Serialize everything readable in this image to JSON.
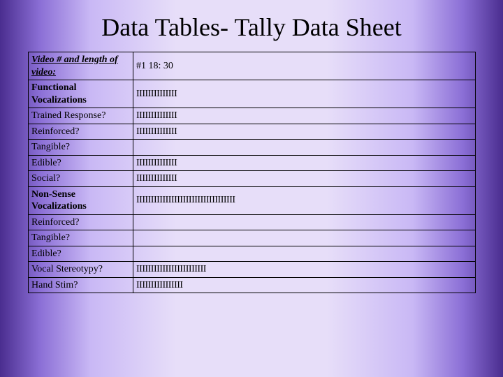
{
  "title": "Data Tables- Tally Data Sheet",
  "header": {
    "label": "Video # and length of video:",
    "value": "#1 18: 30"
  },
  "rows": [
    {
      "label": "Functional Vocalizations",
      "tally": "IIIIIIIIIIIIII",
      "label_class": "section-label",
      "row_class": "two-line"
    },
    {
      "label": "Trained Response?",
      "tally": "IIIIIIIIIIIIII",
      "label_class": "row-label",
      "row_class": ""
    },
    {
      "label": "Reinforced?",
      "tally": "IIIIIIIIIIIIII",
      "label_class": "row-label",
      "row_class": ""
    },
    {
      "label": "Tangible?",
      "tally": "",
      "label_class": "row-label",
      "row_class": ""
    },
    {
      "label": "Edible?",
      "tally": "IIIIIIIIIIIIII",
      "label_class": "row-label",
      "row_class": ""
    },
    {
      "label": "Social?",
      "tally": "IIIIIIIIIIIIII",
      "label_class": "row-label",
      "row_class": ""
    },
    {
      "label": "Non-Sense Vocalizations",
      "tally": "IIIIIIIIIIIIIIIIIIIIIIIIIIIIIIIIII",
      "label_class": "section-label",
      "row_class": "two-line"
    },
    {
      "label": "Reinforced?",
      "tally": "",
      "label_class": "row-label",
      "row_class": ""
    },
    {
      "label": "Tangible?",
      "tally": "",
      "label_class": "row-label",
      "row_class": ""
    },
    {
      "label": "Edible?",
      "tally": "",
      "label_class": "row-label",
      "row_class": ""
    },
    {
      "label": "Vocal Stereotypy?",
      "tally": "IIIIIIIIIIIIIIIIIIIIIIII",
      "label_class": "row-label",
      "row_class": ""
    },
    {
      "label": "Hand Stim?",
      "tally": "IIIIIIIIIIIIIIII",
      "label_class": "row-label",
      "row_class": ""
    }
  ]
}
